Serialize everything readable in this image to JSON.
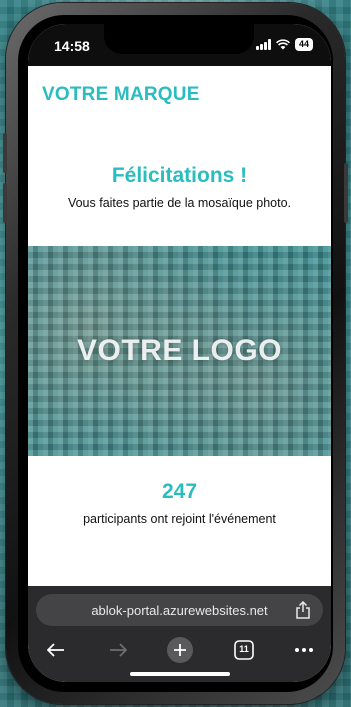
{
  "status_bar": {
    "time": "14:58",
    "battery": "44"
  },
  "page": {
    "brand": "VOTRE MARQUE",
    "headline": "Félicitations !",
    "subline": "Vous faites partie de la mosaïque photo.",
    "mosaic_logo": "VOTRE LOGO",
    "participant_count": "247",
    "participant_label": "participants ont rejoint l'événement"
  },
  "browser": {
    "url": "ablok-portal.azurewebsites.net",
    "tabs_count": "11",
    "icons": [
      "back-icon",
      "forward-icon",
      "new-tab-icon",
      "tabs-icon",
      "more-icon",
      "share-icon"
    ]
  },
  "colors": {
    "accent": "#2bbcc0",
    "mosaic": "#3b8e93",
    "browser_bar": "#2b2b2d"
  }
}
